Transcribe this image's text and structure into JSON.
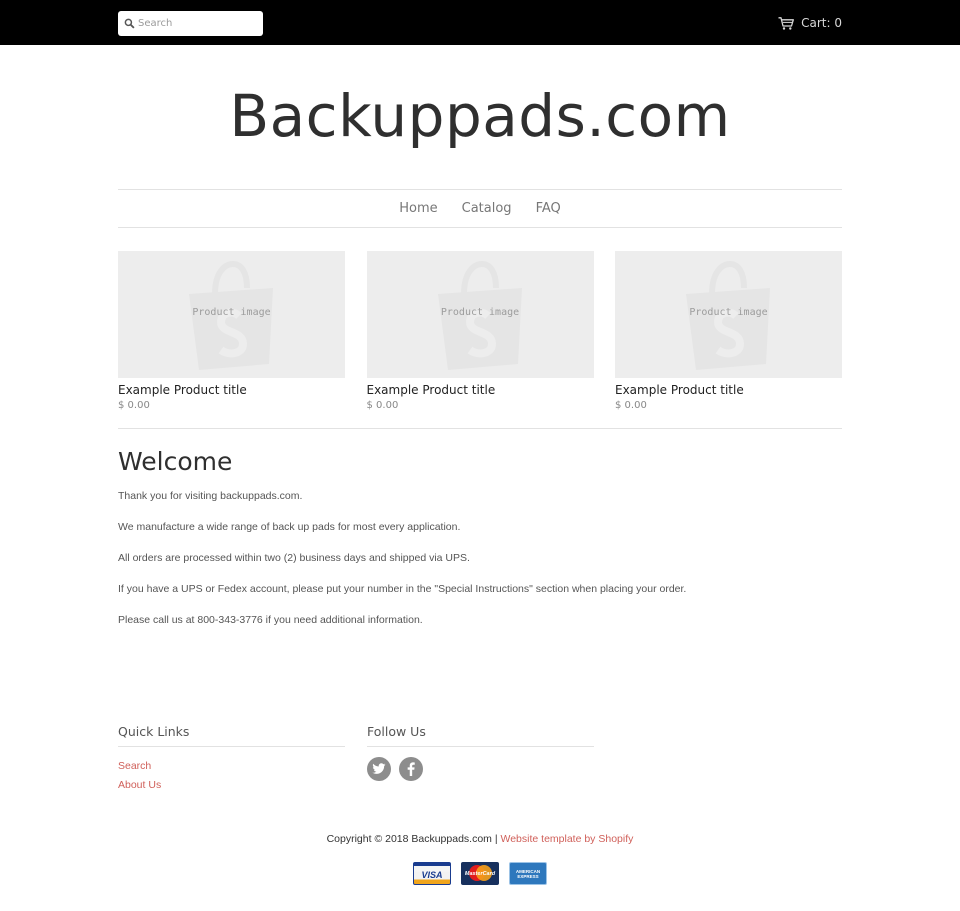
{
  "header": {
    "search": {
      "placeholder": "Search"
    },
    "cart_label": "Cart: 0"
  },
  "site": {
    "title": "Backuppads.com"
  },
  "nav": {
    "items": [
      "Home",
      "Catalog",
      "FAQ"
    ]
  },
  "products": [
    {
      "image_label": "Product image",
      "title": "Example Product title",
      "price": "$ 0.00"
    },
    {
      "image_label": "Product image",
      "title": "Example Product title",
      "price": "$ 0.00"
    },
    {
      "image_label": "Product image",
      "title": "Example Product title",
      "price": "$ 0.00"
    }
  ],
  "welcome": {
    "heading": "Welcome",
    "paragraphs": [
      "Thank you for visiting backuppads.com.",
      "We manufacture a wide range of back up pads for most every application.",
      "All orders are processed within two (2) business days and shipped via UPS.",
      "If you have a UPS or Fedex account, please put your number in the \"Special Instructions\" section when placing your order.",
      "Please call us at 800-343-3776 if you need additional information."
    ]
  },
  "footer": {
    "quick_links": {
      "heading": "Quick Links",
      "items": [
        "Search",
        "About Us"
      ]
    },
    "follow_us": {
      "heading": "Follow Us",
      "icons": [
        "twitter-icon",
        "facebook-icon"
      ]
    },
    "copyright": "Copyright © 2018 Backuppads.com | ",
    "template_link": "Website template by Shopify",
    "payment_cards": [
      {
        "icon": "visa-icon",
        "label": "VISA"
      },
      {
        "icon": "mastercard-icon",
        "label": "MasterCard"
      },
      {
        "icon": "american-express-icon",
        "label": "AMERICAN EXPRESS"
      }
    ]
  },
  "colors": {
    "topbar": "#000000",
    "link": "#d0605a",
    "placeholder_bg": "#ededed"
  }
}
